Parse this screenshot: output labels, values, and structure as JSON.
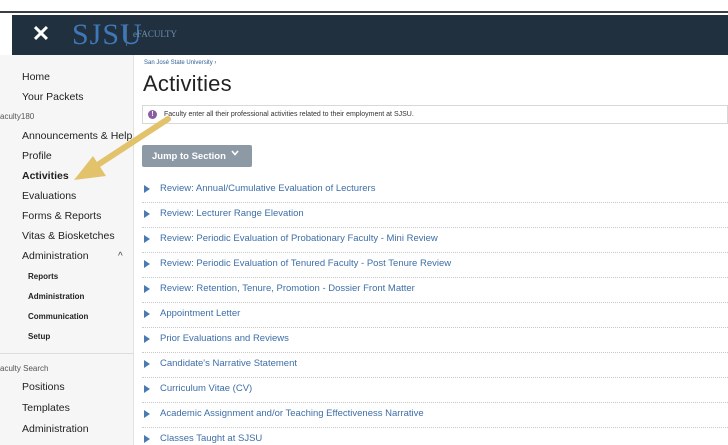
{
  "header": {
    "logo": "SJSU",
    "subtitle": "eFACULTY",
    "close_icon": "✕"
  },
  "sidebar": {
    "items": [
      {
        "label": "Home"
      },
      {
        "label": "Your Packets"
      },
      {
        "label": "aculty180"
      },
      {
        "label": "Announcements & Help"
      },
      {
        "label": "Profile"
      },
      {
        "label": "Activities"
      },
      {
        "label": "Evaluations"
      },
      {
        "label": "Forms & Reports"
      },
      {
        "label": "Vitas & Biosketches"
      },
      {
        "label": "Administration"
      },
      {
        "label": "Reports"
      },
      {
        "label": "Administration"
      },
      {
        "label": "Communication"
      },
      {
        "label": "Setup"
      },
      {
        "label": "aculty Search"
      },
      {
        "label": "Positions"
      },
      {
        "label": "Templates"
      },
      {
        "label": "Administration"
      }
    ],
    "collapse_icon": "^"
  },
  "main": {
    "breadcrumb": "San José State University ›",
    "title": "Activities",
    "info": "Faculty enter all their professional activities related to their employment at SJSU.",
    "info_icon": "!",
    "jump_label": "Jump to Section",
    "sections": [
      {
        "label": "Review: Annual/Cumulative Evaluation of Lecturers"
      },
      {
        "label": "Review: Lecturer Range Elevation"
      },
      {
        "label": "Review: Periodic Evaluation of Probationary Faculty - Mini Review"
      },
      {
        "label": "Review: Periodic Evaluation of Tenured Faculty - Post Tenure Review"
      },
      {
        "label": "Review: Retention, Tenure, Promotion - Dossier Front Matter"
      },
      {
        "label": "Appointment Letter"
      },
      {
        "label": "Prior Evaluations and Reviews"
      },
      {
        "label": "Candidate's Narrative Statement"
      },
      {
        "label": "Curriculum Vitae (CV)"
      },
      {
        "label": "Academic Assignment and/or Teaching Effectiveness Narrative"
      },
      {
        "label": "Classes Taught at SJSU"
      }
    ]
  },
  "colors": {
    "header_bg": "#20303f",
    "logo": "#3f78b8",
    "link": "#3d6ea8",
    "button": "#8d9aa6",
    "arrow": "#e2c26a",
    "info_icon": "#8a5ca6"
  }
}
